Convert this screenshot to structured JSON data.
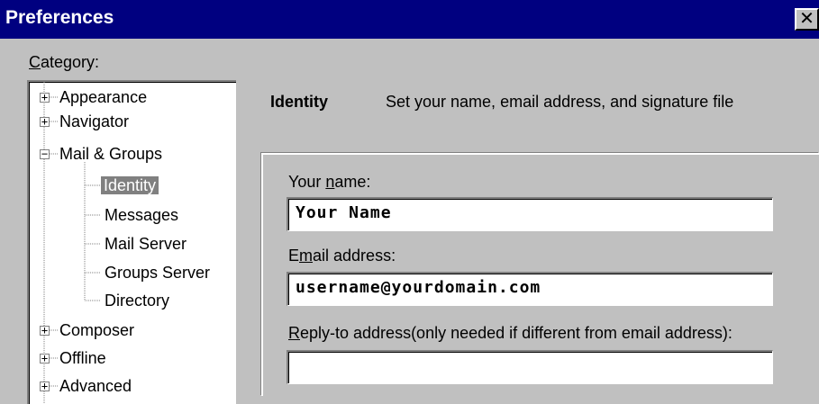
{
  "window": {
    "title": "Preferences",
    "close_glyph": "✕"
  },
  "category": {
    "label_prefix": "",
    "label_hotkey": "C",
    "label_rest": "ategory:"
  },
  "tree": {
    "items": [
      {
        "label": "Appearance",
        "expander": "+"
      },
      {
        "label": "Navigator",
        "expander": "+"
      },
      {
        "label": "Mail & Groups",
        "expander": "−"
      },
      {
        "label": "Identity",
        "selected": true
      },
      {
        "label": "Messages"
      },
      {
        "label": "Mail Server"
      },
      {
        "label": "Groups Server"
      },
      {
        "label": "Directory"
      },
      {
        "label": "Composer",
        "expander": "+"
      },
      {
        "label": "Offline",
        "expander": "+"
      },
      {
        "label": "Advanced",
        "expander": "+"
      }
    ]
  },
  "panel": {
    "title": "Identity",
    "description": "Set your name, email address, and signature file"
  },
  "form": {
    "name": {
      "label_prefix": "Your ",
      "label_hotkey": "n",
      "label_rest": "ame:",
      "value": "Your Name"
    },
    "email": {
      "label_prefix": "E",
      "label_hotkey": "m",
      "label_rest": "ail address:",
      "value": "username@yourdomain.com"
    },
    "reply_to": {
      "label_prefix": "",
      "label_hotkey": "R",
      "label_rest": "eply-to address(only needed if different from email address):",
      "value": ""
    }
  }
}
